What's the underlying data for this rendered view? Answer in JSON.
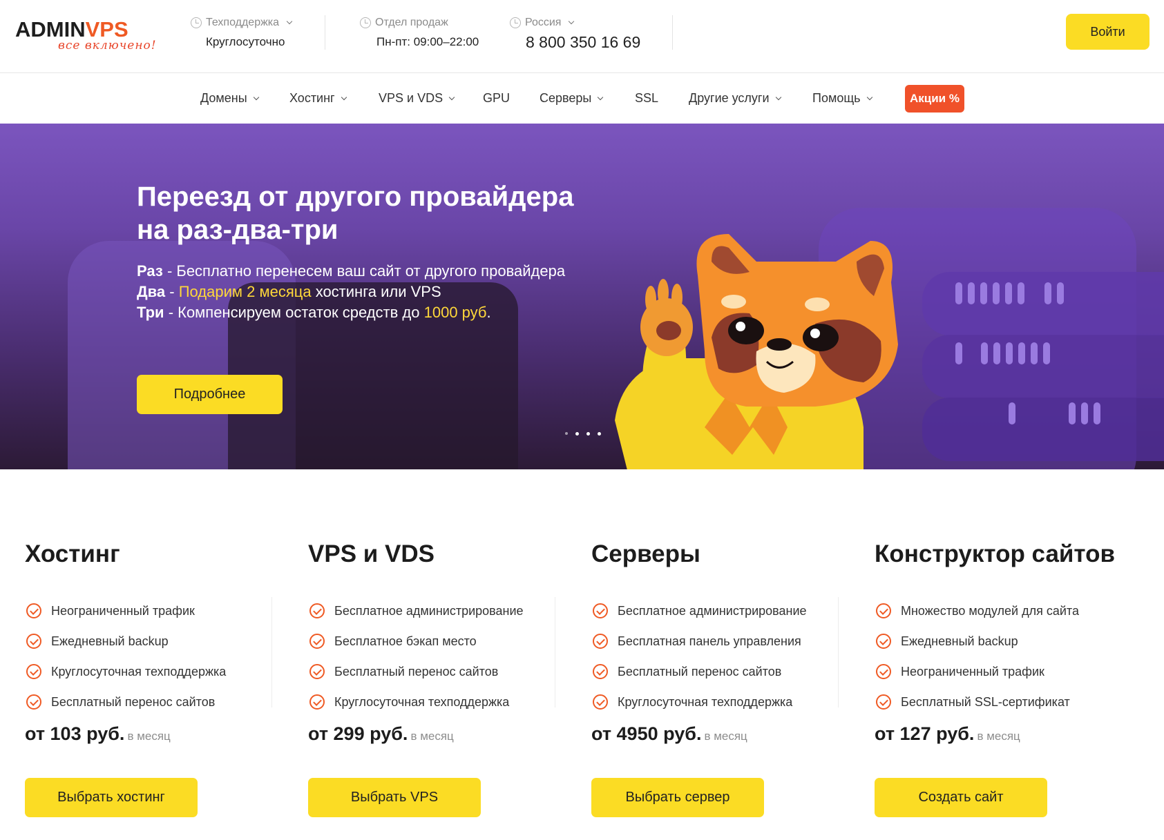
{
  "header": {
    "logo_main_a": "ADMIN",
    "logo_main_b": "V",
    "logo_main_c": "PS",
    "logo_tagline": "все включено!",
    "support": {
      "label": "Техподдержка",
      "value": "Круглосуточно"
    },
    "sales": {
      "label": "Отдел продаж",
      "value": "Пн-пт: 09:00–22:00"
    },
    "region": {
      "label": "Россия",
      "phone": "8 800 350 16 69"
    },
    "login_label": "Войти"
  },
  "nav": {
    "items": [
      {
        "label": "Домены",
        "dropdown": true
      },
      {
        "label": "Хостинг",
        "dropdown": true
      },
      {
        "label": "VPS и VDS",
        "dropdown": true
      },
      {
        "label": "GPU",
        "dropdown": false
      },
      {
        "label": "Серверы",
        "dropdown": true
      },
      {
        "label": "SSL",
        "dropdown": false
      },
      {
        "label": "Другие услуги",
        "dropdown": true
      },
      {
        "label": "Помощь",
        "dropdown": true
      }
    ],
    "promo_label": "Акции %",
    "promo_color": "#f0512a"
  },
  "hero": {
    "title_line1": "Переезд от другого провайдера",
    "title_line2": "на раз-два-три",
    "line1_key": "Раз",
    "line1_text": " - Бесплатно перенесем ваш сайт от другого провайдера",
    "line2_key": "Два",
    "line2_sep": " - ",
    "line2_highlight": "Подарим 2 месяца",
    "line2_text": " хостинга или VPS",
    "line3_key": "Три",
    "line3_text": " - Компенсируем остаток средств до ",
    "line3_highlight": "1000 руб",
    "line3_end": ".",
    "button_label": "Подробнее",
    "slides_total": 4,
    "slide_active": 1
  },
  "products": [
    {
      "title": "Хостинг",
      "features": [
        "Неограниченный трафик",
        "Ежедневный backup",
        "Круглосуточная техподдержка",
        "Бесплатный перенос сайтов"
      ],
      "price": "от 103 руб.",
      "per": "в месяц",
      "button": "Выбрать хостинг"
    },
    {
      "title": "VPS и VDS",
      "features": [
        "Бесплатное администрирование",
        "Бесплатное бэкап место",
        "Бесплатный перенос сайтов",
        "Круглосуточная техподдержка"
      ],
      "price": "от 299 руб.",
      "per": "в месяц",
      "button": "Выбрать VPS"
    },
    {
      "title": "Серверы",
      "features": [
        "Бесплатное администрирование",
        "Бесплатная панель управления",
        "Бесплатный перенос сайтов",
        "Круглосуточная техподдержка"
      ],
      "price": "от 4950 руб.",
      "per": "в месяц",
      "button": "Выбрать сервер"
    },
    {
      "title": "Конструктор сайтов",
      "features": [
        "Множество модулей для сайта",
        "Ежедневный backup",
        "Неограниченный трафик",
        "Бесплатный SSL-сертификат"
      ],
      "price": "от 127 руб.",
      "per": "в месяц",
      "button": "Создать сайт"
    }
  ],
  "colors": {
    "accent_yellow": "#fbdc24",
    "brand_orange": "#ef5a24",
    "hero_purple": "#6a46a8"
  },
  "icons": {
    "clock": "clock-icon",
    "check": "check-circle-icon",
    "dropdown": "chevron-down-icon"
  }
}
